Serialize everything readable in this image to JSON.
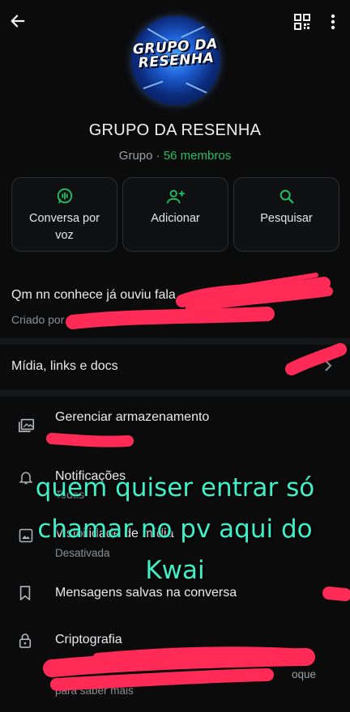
{
  "header": {
    "back_icon": "arrow-left-icon",
    "qr_icon": "qr-code-icon",
    "more_icon": "more-vertical-icon"
  },
  "group": {
    "avatar_text_line1": "GRUPO DA",
    "avatar_text_line2": "RESENHA",
    "name": "GRUPO DA RESENHA",
    "type": "Grupo",
    "separator": " · ",
    "members": "56 membros"
  },
  "actions": [
    {
      "label": "Conversa por voz",
      "icon": "voice-chat-icon"
    },
    {
      "label": "Adicionar",
      "icon": "add-person-icon"
    },
    {
      "label": "Pesquisar",
      "icon": "search-icon"
    }
  ],
  "description": {
    "text": "Qm nn conhece já ouviu fala",
    "created_prefix": "Criado por"
  },
  "media_row": {
    "label": "Mídia, links e docs"
  },
  "settings": [
    {
      "title": "Gerenciar armazenamento",
      "subtitle": "",
      "icon": "storage-folder-icon"
    },
    {
      "title": "Notificações",
      "subtitle": "Todas",
      "icon": "bell-icon"
    },
    {
      "title": "Visibilidade de mídia",
      "subtitle": "Desativada",
      "icon": "image-icon"
    },
    {
      "title": "Mensagens salvas na conversa",
      "subtitle": "",
      "icon": "bookmark-icon"
    },
    {
      "title": "Criptografia",
      "subtitle": "para saber mais",
      "icon": "lock-icon"
    }
  ],
  "encryption_partial": "oque",
  "overlay_text": {
    "line1": "quem quiser entrar só",
    "line2": "chamar no pv aqui do",
    "line3": "Kwai"
  },
  "colors": {
    "background": "#0b0b0c",
    "accent_green": "#21c063",
    "scribble_red": "#ff2a55",
    "overlay_teal": "#3ef0c8"
  }
}
